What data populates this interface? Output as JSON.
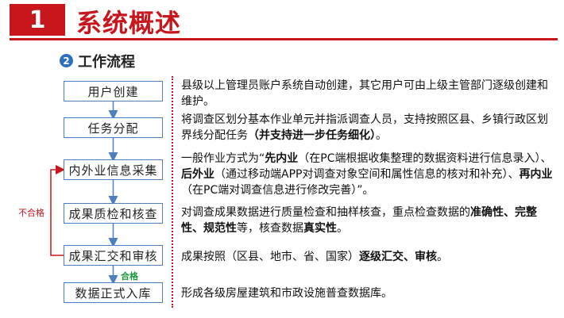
{
  "header": {
    "number": "1",
    "title": "系统概述"
  },
  "section": {
    "number": "2",
    "title": "工作流程"
  },
  "flow": {
    "steps": [
      "用户创建",
      "任务分配",
      "内外业信息采集",
      "成果质检和核查",
      "成果汇交和审核",
      "数据正式入库"
    ],
    "fail_label": "不合格",
    "pass_label": "合格"
  },
  "descriptions": {
    "d0": "县级以上管理员账户系统自动创建，其它用户可由上级主管部门逐级创建和维护。",
    "d1_a": "将调查区划分基本作业单元并指派调查人员，支持按照区县、乡镇行政区划界线分配任务",
    "d1_b": "（并支持进一步任务细化）",
    "d1_c": "。",
    "d2_a": "一般作业方式为“",
    "d2_b": "先内业",
    "d2_c": "（在PC端根据收集整理的数据资料进行信息录入）、",
    "d2_d": "后外业",
    "d2_e": "（通过移动端APP对调查对象空间和属性信息的核对和补充）、",
    "d2_f": "再内业",
    "d2_g": "（在PC端对调查信息进行修改完善）”。",
    "d3_a": "对调查成果数据进行质量检查和抽样核查，重点检查数据的",
    "d3_b": "准确性、完整性、规范性",
    "d3_c": "等，核查数据",
    "d3_d": "真实性",
    "d3_e": "。",
    "d4_a": "成果按照（区县、地市、省、国家）",
    "d4_b": "逐级汇交、审核",
    "d4_c": "。",
    "d5": "形成各级房屋建筑和市政设施普查数据库。"
  },
  "colors": {
    "accent_red": "#c8161d",
    "flow_blue": "#4b7fc0",
    "pass_green": "#1a9a3a",
    "badge_blue": "#2f6fc0"
  }
}
